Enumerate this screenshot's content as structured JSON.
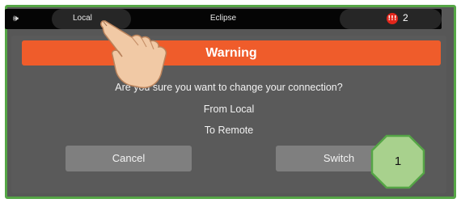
{
  "statusbar": {
    "mode_icon": "speaker-icon",
    "mode_label": "Local",
    "system_name": "Eclipse",
    "alarm_icon": "alarm-badge-icon",
    "alarm_count": "2"
  },
  "dialog": {
    "title": "Warning",
    "message": "Are you sure you want to change your connection?",
    "from_line": "From Local",
    "to_line": "To Remote",
    "cancel_label": "Cancel",
    "switch_label": "Switch"
  },
  "annotation": {
    "step_number": "1",
    "pointer_icon": "pointing-hand-icon"
  },
  "colors": {
    "frame_border": "#55a546",
    "warning_bar": "#ef5c2b",
    "alarm_badge": "#e3261b",
    "step_marker_fill": "#a8d18d",
    "step_marker_border": "#55a546"
  }
}
